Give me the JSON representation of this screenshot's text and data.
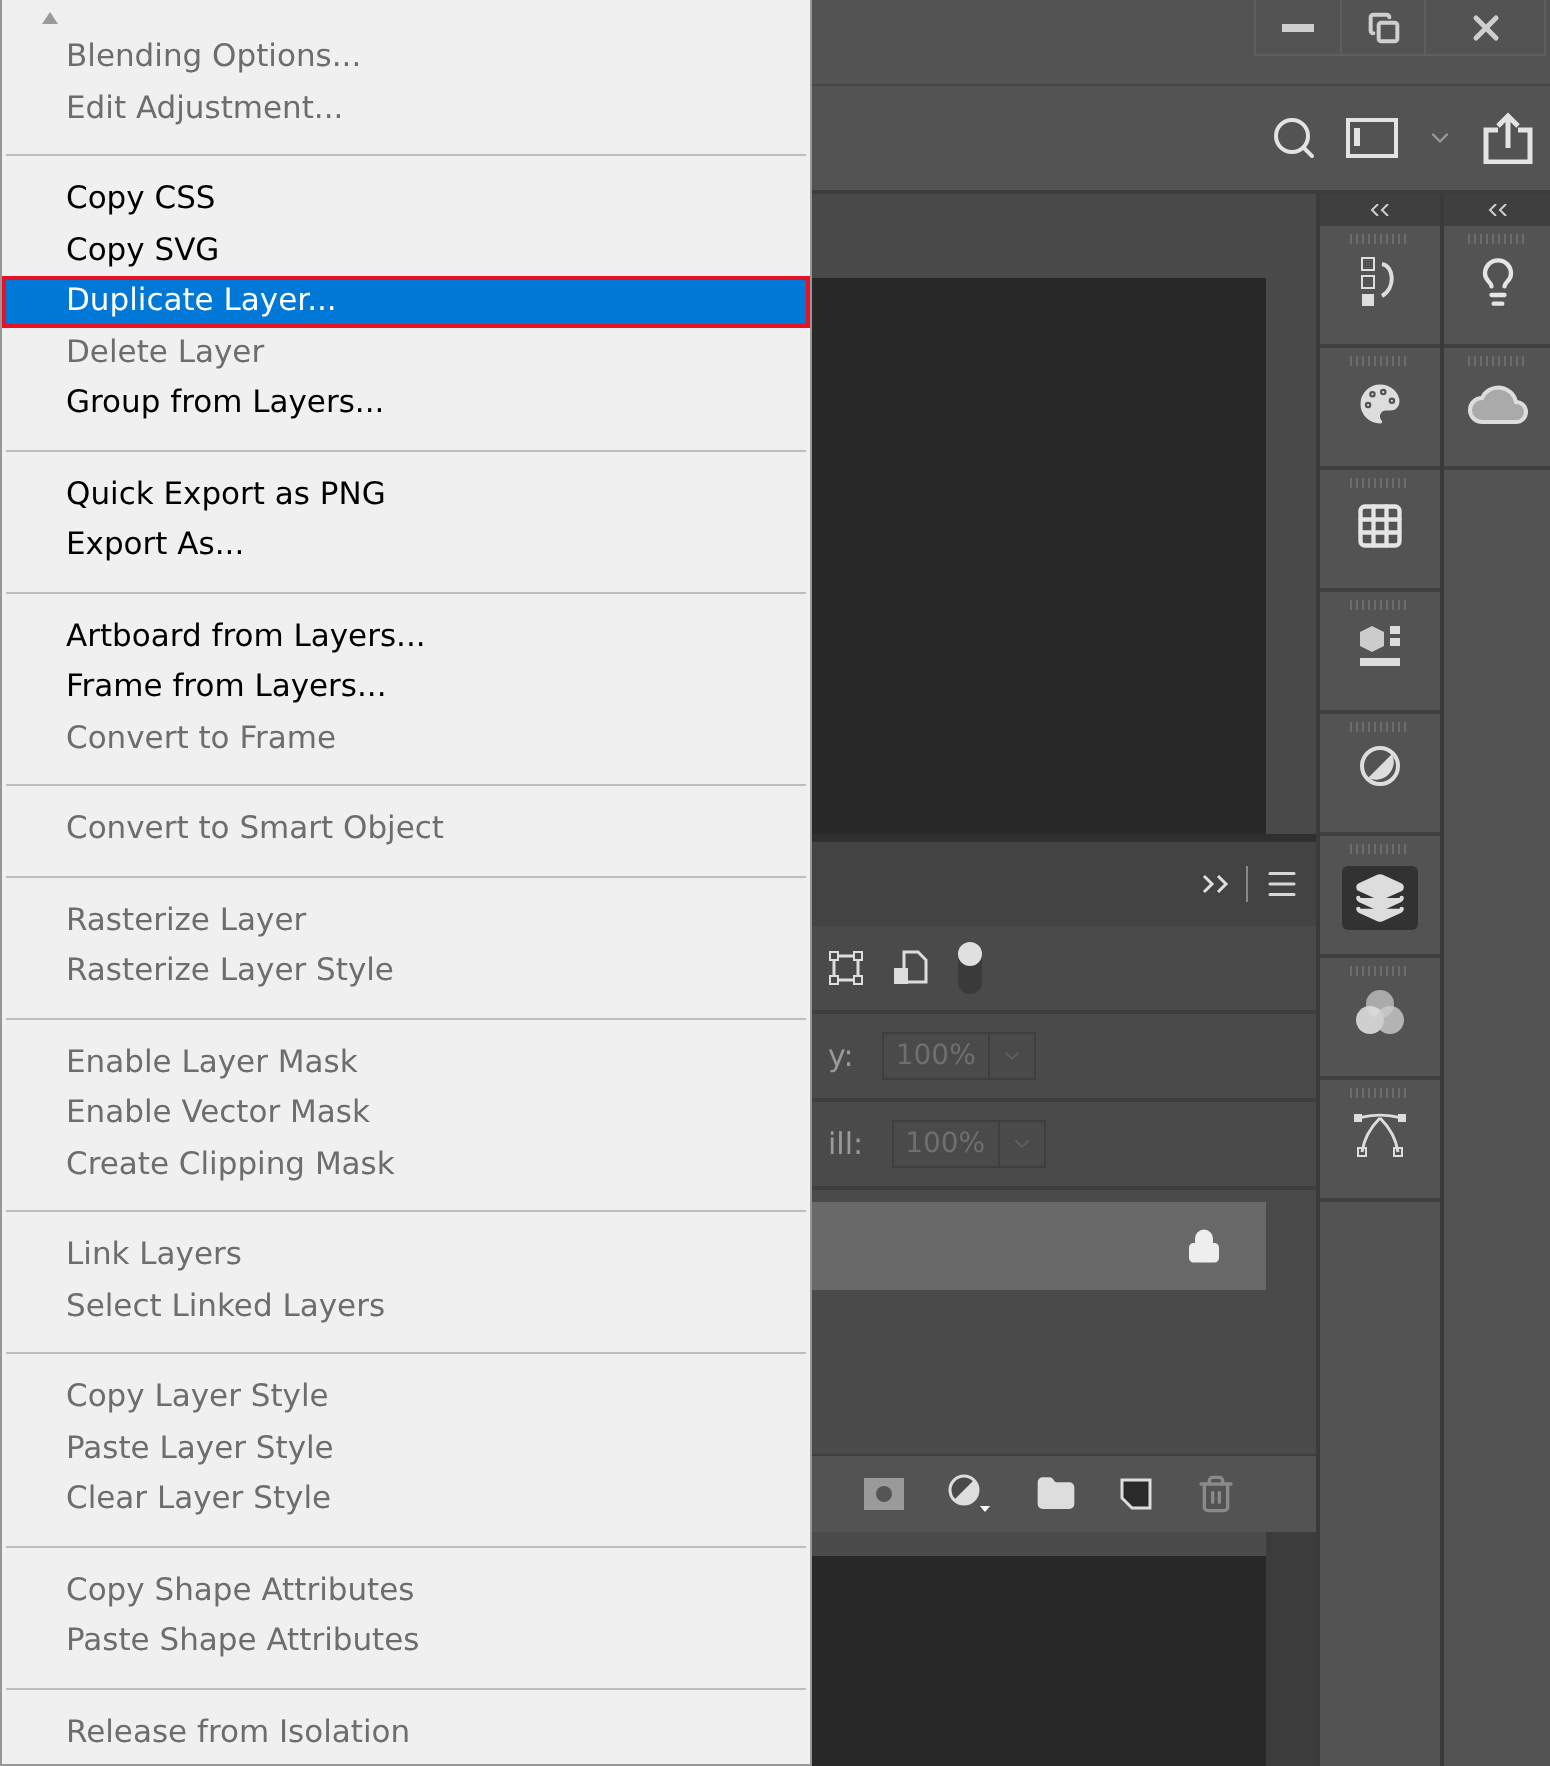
{
  "context_menu": {
    "groups": [
      {
        "items": [
          {
            "label": "Blending Options...",
            "disabled": true,
            "selected": false
          },
          {
            "label": "Edit Adjustment...",
            "disabled": true,
            "selected": false
          }
        ]
      },
      {
        "items": [
          {
            "label": "Copy CSS",
            "disabled": false,
            "selected": false
          },
          {
            "label": "Copy SVG",
            "disabled": false,
            "selected": false
          },
          {
            "label": "Duplicate Layer...",
            "disabled": false,
            "selected": true
          },
          {
            "label": "Delete Layer",
            "disabled": true,
            "selected": false
          },
          {
            "label": "Group from Layers...",
            "disabled": false,
            "selected": false
          }
        ]
      },
      {
        "items": [
          {
            "label": "Quick Export as PNG",
            "disabled": false,
            "selected": false
          },
          {
            "label": "Export As...",
            "disabled": false,
            "selected": false
          }
        ]
      },
      {
        "items": [
          {
            "label": "Artboard from Layers...",
            "disabled": false,
            "selected": false
          },
          {
            "label": "Frame from Layers...",
            "disabled": false,
            "selected": false
          },
          {
            "label": "Convert to Frame",
            "disabled": true,
            "selected": false
          }
        ]
      },
      {
        "items": [
          {
            "label": "Convert to Smart Object",
            "disabled": true,
            "selected": false
          }
        ]
      },
      {
        "items": [
          {
            "label": "Rasterize Layer",
            "disabled": true,
            "selected": false
          },
          {
            "label": "Rasterize Layer Style",
            "disabled": true,
            "selected": false
          }
        ]
      },
      {
        "items": [
          {
            "label": "Enable Layer Mask",
            "disabled": true,
            "selected": false
          },
          {
            "label": "Enable Vector Mask",
            "disabled": true,
            "selected": false
          },
          {
            "label": "Create Clipping Mask",
            "disabled": true,
            "selected": false
          }
        ]
      },
      {
        "items": [
          {
            "label": "Link Layers",
            "disabled": true,
            "selected": false
          },
          {
            "label": "Select Linked Layers",
            "disabled": true,
            "selected": false
          }
        ]
      },
      {
        "items": [
          {
            "label": "Copy Layer Style",
            "disabled": true,
            "selected": false
          },
          {
            "label": "Paste Layer Style",
            "disabled": true,
            "selected": false
          },
          {
            "label": "Clear Layer Style",
            "disabled": true,
            "selected": false
          }
        ]
      },
      {
        "items": [
          {
            "label": "Copy Shape Attributes",
            "disabled": true,
            "selected": false
          },
          {
            "label": "Paste Shape Attributes",
            "disabled": true,
            "selected": false
          }
        ]
      },
      {
        "items": [
          {
            "label": "Release from Isolation",
            "disabled": true,
            "selected": false
          }
        ]
      }
    ]
  },
  "layers_panel": {
    "fields": [
      {
        "label": "y:",
        "value": "100%"
      },
      {
        "label": "ill:",
        "value": "100%"
      }
    ]
  }
}
